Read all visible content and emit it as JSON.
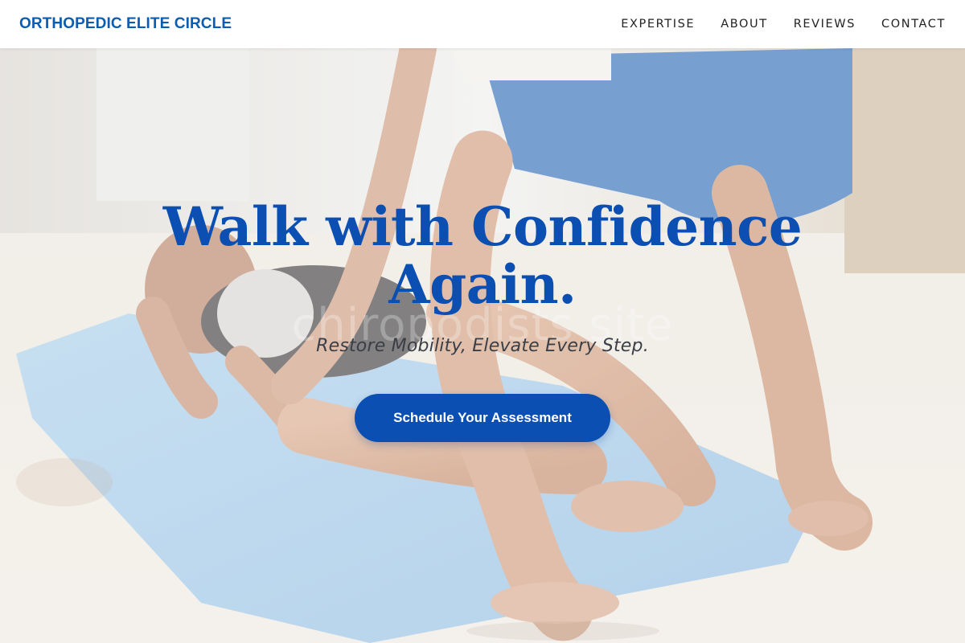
{
  "colors": {
    "brand": "#0a5db0",
    "heading": "#0b4fb3",
    "button_bg": "#0b4fb3",
    "button_text": "#ffffff",
    "nav_text": "#222222"
  },
  "nav": {
    "brand": "ORTHOPEDIC ELITE CIRCLE",
    "links": [
      {
        "label": "EXPERTISE"
      },
      {
        "label": "ABOUT"
      },
      {
        "label": "REVIEWS"
      },
      {
        "label": "CONTACT"
      }
    ]
  },
  "hero": {
    "title_line1": "Walk with Confidence",
    "title_line2": "Again.",
    "watermark": "chiropodists site",
    "subtitle": "Restore Mobility, Elevate Every Step.",
    "cta_label": "Schedule Your Assessment",
    "image_icon": "hero-photo"
  }
}
